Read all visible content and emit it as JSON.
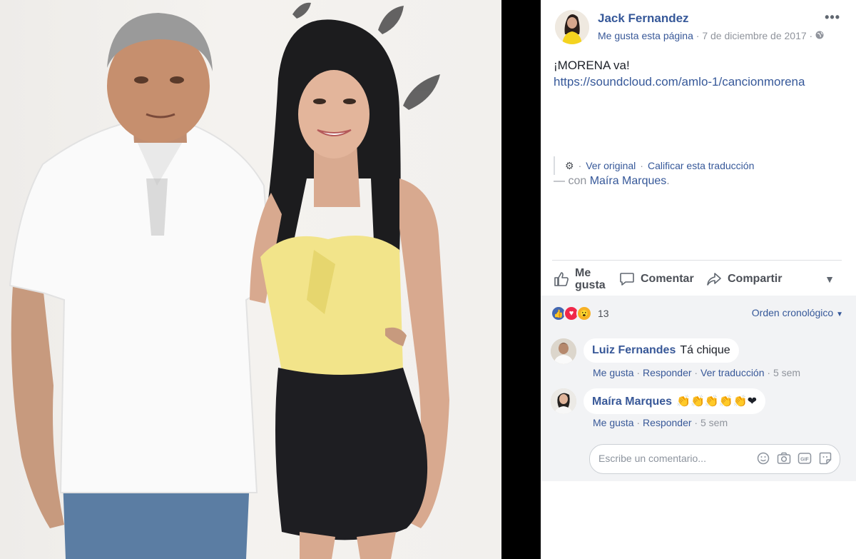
{
  "post": {
    "author": "Jack Fernandez",
    "page_like": "Me gusta esta página",
    "date": "7 de diciembre de 2017",
    "text": "¡MORENA va!",
    "link": "https://soundcloud.com/amlo-1/cancionmorena",
    "see_original": "Ver original",
    "rate_translation": "Calificar esta traducción",
    "with_prefix": "— con",
    "tagged_name": "Maíra Marques",
    "tagged_suffix": "."
  },
  "actions": {
    "like_line1": "Me",
    "like_line2": "gusta",
    "comment": "Comentar",
    "share": "Compartir"
  },
  "reactions": {
    "icons": [
      "like-icon",
      "love-icon",
      "wow-icon"
    ],
    "count": "13",
    "order": "Orden cronológico"
  },
  "comments": [
    {
      "name": "Luiz Fernandes",
      "text": "Tá chique",
      "like": "Me gusta",
      "reply": "Responder",
      "translate": "Ver traducción",
      "time": "5 sem"
    },
    {
      "name": "Maíra Marques",
      "text": "👏👏👏👏👏❤",
      "like": "Me gusta",
      "reply": "Responder",
      "time": "5 sem"
    }
  ],
  "composer": {
    "placeholder": "Escribe un comentario...",
    "icons": [
      "emoji-icon",
      "camera-icon",
      "gif-icon",
      "sticker-icon"
    ]
  },
  "colors": {
    "link": "#365899",
    "meta": "#90949c",
    "panel_bg": "#f2f3f5"
  }
}
